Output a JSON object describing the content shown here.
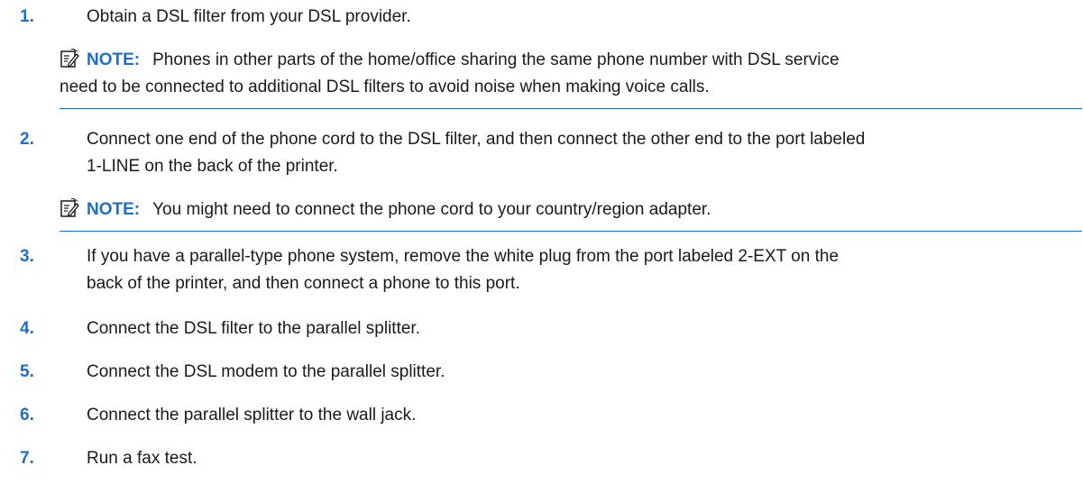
{
  "steps": [
    {
      "num": "1.",
      "text": "Obtain a DSL filter from your DSL provider."
    },
    {
      "num": "2.",
      "text_line1": "Connect one end of the phone cord to the DSL filter, and then connect the other end to the port labeled",
      "text_line2": "1-LINE on the back of the printer."
    },
    {
      "num": "3.",
      "text_line1": "If you have a parallel-type phone system, remove the white plug from the port labeled 2-EXT on the",
      "text_line2": "back of the printer, and then connect a phone to this port."
    },
    {
      "num": "4.",
      "text": "Connect the DSL filter to the parallel splitter."
    },
    {
      "num": "5.",
      "text": "Connect the DSL modem to the parallel splitter."
    },
    {
      "num": "6.",
      "text": "Connect the parallel splitter to the wall jack."
    },
    {
      "num": "7.",
      "text": "Run a fax test."
    }
  ],
  "notes": [
    {
      "label": "NOTE:",
      "line1": "Phones in other parts of the home/office sharing the same phone number with DSL service",
      "line2": "need to be connected to additional DSL filters to avoid noise when making voice calls.",
      "icon": "note-icon"
    },
    {
      "label": "NOTE:",
      "line1": "You might need to connect the phone cord to your country/region adapter.",
      "icon": "note-icon"
    }
  ],
  "colors": {
    "accent": "#1e6fc4",
    "text": "#1a1a1a"
  }
}
